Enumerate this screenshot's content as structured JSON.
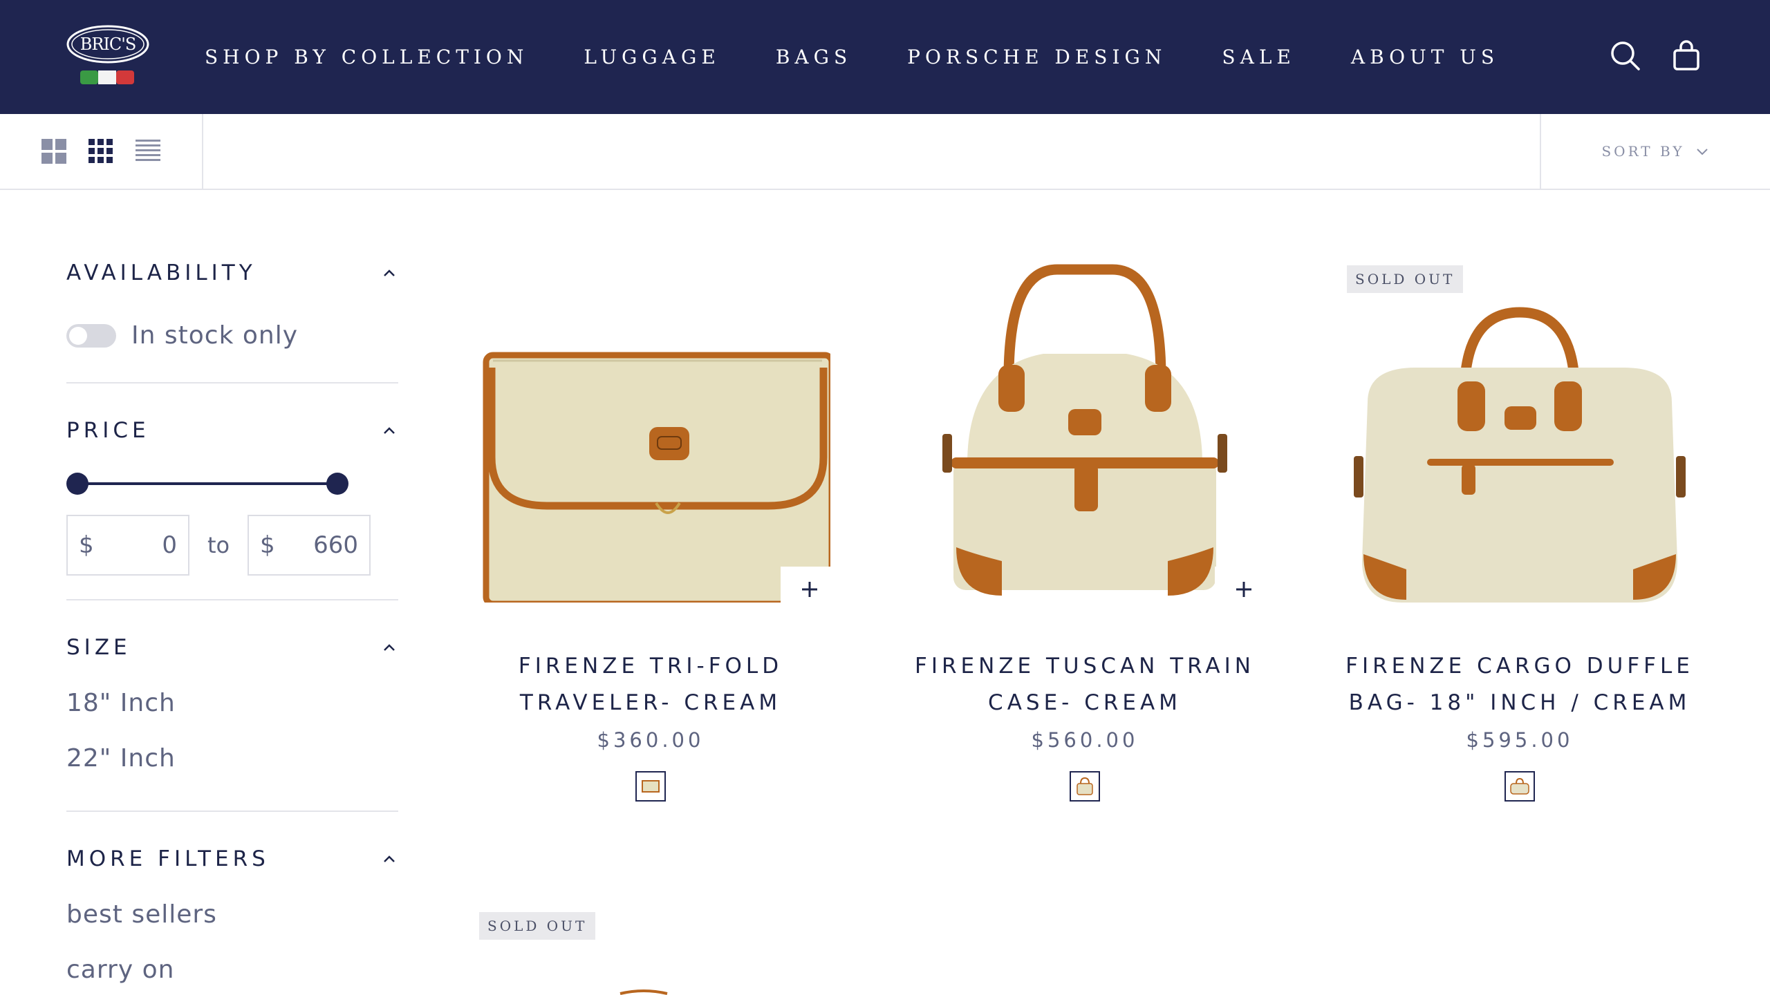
{
  "header": {
    "logo_text": "BRIC'S",
    "nav": [
      {
        "label": "SHOP BY COLLECTION"
      },
      {
        "label": "LUGGAGE"
      },
      {
        "label": "BAGS"
      },
      {
        "label": "PORSCHE DESIGN"
      },
      {
        "label": "SALE"
      },
      {
        "label": "ABOUT US"
      }
    ],
    "icons": [
      "search-icon",
      "cart-bag-icon"
    ],
    "background_color": "#1f2550"
  },
  "toolbar": {
    "view_modes": [
      "grid-large-icon",
      "grid-small-icon",
      "list-icon"
    ],
    "sort_label": "SORT BY"
  },
  "filters": {
    "availability": {
      "title": "AVAILABILITY",
      "toggle_label": "In stock only",
      "toggle_on": false
    },
    "price": {
      "title": "PRICE",
      "currency": "$",
      "min": "0",
      "max": "660",
      "to_label": "to"
    },
    "size": {
      "title": "SIZE",
      "options": [
        "18\" Inch",
        "22\" Inch"
      ]
    },
    "more": {
      "title": "MORE FILTERS",
      "options": [
        "best sellers",
        "carry on"
      ]
    }
  },
  "products": [
    {
      "name": "FIRENZE TRI-FOLD TRAVELER- CREAM",
      "name_line1": "FIRENZE TRI-FOLD",
      "name_line2": "TRAVELER- CREAM",
      "price": "$360.00",
      "badge": ""
    },
    {
      "name": "FIRENZE TUSCAN TRAIN CASE- CREAM",
      "name_line1": "FIRENZE TUSCAN TRAIN",
      "name_line2": "CASE- CREAM",
      "price": "$560.00",
      "badge": ""
    },
    {
      "name": "FIRENZE CARGO DUFFLE BAG- 18\" INCH / CREAM",
      "name_line1": "FIRENZE CARGO DUFFLE",
      "name_line2": "BAG- 18\" INCH / CREAM",
      "price": "$595.00",
      "badge": "SOLD OUT"
    },
    {
      "name": "",
      "price": "",
      "badge": "SOLD OUT"
    }
  ],
  "colors": {
    "navy": "#1f2550",
    "cream": "#e8e2c4",
    "leather": "#b8661f"
  }
}
